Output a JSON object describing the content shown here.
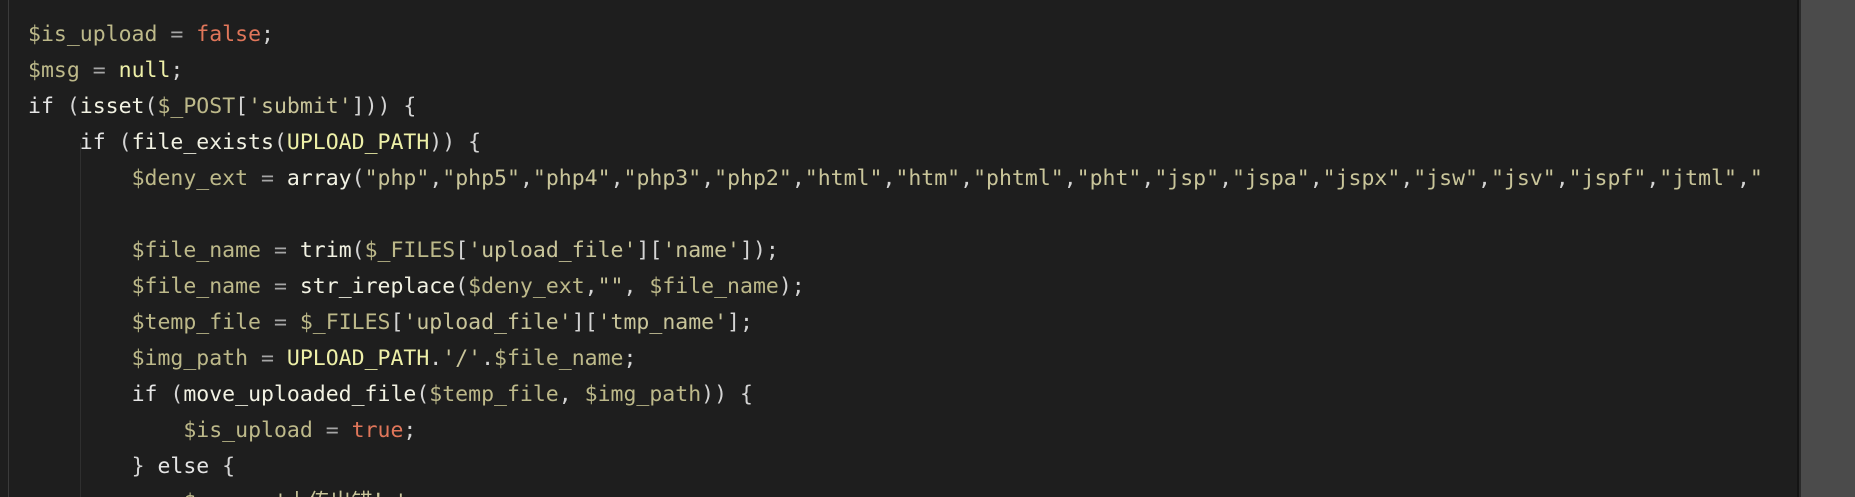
{
  "colors": {
    "background": "#1e1e1e",
    "variable": "#bdb98a",
    "keyword": "#e5e5e5",
    "function": "#f2f2e3",
    "constant": "#eef0a8",
    "string": "#c9c59a",
    "literal": "#e0765a",
    "operator": "#a6a6a6",
    "default": "#d4d4d4"
  },
  "editor": {
    "lines": [
      {
        "indent": 0,
        "tokens": [
          {
            "t": "$is_upload",
            "c": "variable"
          },
          {
            "t": " = ",
            "c": "operator"
          },
          {
            "t": "false",
            "c": "literal"
          },
          {
            "t": ";",
            "c": "default"
          }
        ]
      },
      {
        "indent": 0,
        "tokens": [
          {
            "t": "$msg",
            "c": "variable"
          },
          {
            "t": " = ",
            "c": "operator"
          },
          {
            "t": "null",
            "c": "constant"
          },
          {
            "t": ";",
            "c": "default"
          }
        ]
      },
      {
        "indent": 0,
        "tokens": [
          {
            "t": "if",
            "c": "keyword"
          },
          {
            "t": " (",
            "c": "default"
          },
          {
            "t": "isset",
            "c": "function"
          },
          {
            "t": "(",
            "c": "default"
          },
          {
            "t": "$_POST",
            "c": "variable"
          },
          {
            "t": "[",
            "c": "default"
          },
          {
            "t": "'submit'",
            "c": "string"
          },
          {
            "t": "])) {",
            "c": "default"
          }
        ]
      },
      {
        "indent": 1,
        "tokens": [
          {
            "t": "if",
            "c": "keyword"
          },
          {
            "t": " (",
            "c": "default"
          },
          {
            "t": "file_exists",
            "c": "function"
          },
          {
            "t": "(",
            "c": "default"
          },
          {
            "t": "UPLOAD_PATH",
            "c": "constant"
          },
          {
            "t": ")) {",
            "c": "default"
          }
        ]
      },
      {
        "indent": 2,
        "tokens": [
          {
            "t": "$deny_ext",
            "c": "variable"
          },
          {
            "t": " = ",
            "c": "operator"
          },
          {
            "t": "array",
            "c": "function"
          },
          {
            "t": "(",
            "c": "default"
          },
          {
            "t": "\"php\"",
            "c": "string"
          },
          {
            "t": ",",
            "c": "default"
          },
          {
            "t": "\"php5\"",
            "c": "string"
          },
          {
            "t": ",",
            "c": "default"
          },
          {
            "t": "\"php4\"",
            "c": "string"
          },
          {
            "t": ",",
            "c": "default"
          },
          {
            "t": "\"php3\"",
            "c": "string"
          },
          {
            "t": ",",
            "c": "default"
          },
          {
            "t": "\"php2\"",
            "c": "string"
          },
          {
            "t": ",",
            "c": "default"
          },
          {
            "t": "\"html\"",
            "c": "string"
          },
          {
            "t": ",",
            "c": "default"
          },
          {
            "t": "\"htm\"",
            "c": "string"
          },
          {
            "t": ",",
            "c": "default"
          },
          {
            "t": "\"phtml\"",
            "c": "string"
          },
          {
            "t": ",",
            "c": "default"
          },
          {
            "t": "\"pht\"",
            "c": "string"
          },
          {
            "t": ",",
            "c": "default"
          },
          {
            "t": "\"jsp\"",
            "c": "string"
          },
          {
            "t": ",",
            "c": "default"
          },
          {
            "t": "\"jspa\"",
            "c": "string"
          },
          {
            "t": ",",
            "c": "default"
          },
          {
            "t": "\"jspx\"",
            "c": "string"
          },
          {
            "t": ",",
            "c": "default"
          },
          {
            "t": "\"jsw\"",
            "c": "string"
          },
          {
            "t": ",",
            "c": "default"
          },
          {
            "t": "\"jsv\"",
            "c": "string"
          },
          {
            "t": ",",
            "c": "default"
          },
          {
            "t": "\"jspf\"",
            "c": "string"
          },
          {
            "t": ",",
            "c": "default"
          },
          {
            "t": "\"jtml\"",
            "c": "string"
          },
          {
            "t": ",",
            "c": "default"
          },
          {
            "t": "\"",
            "c": "string"
          }
        ]
      },
      {
        "indent": 0,
        "tokens": []
      },
      {
        "indent": 2,
        "tokens": [
          {
            "t": "$file_name",
            "c": "variable"
          },
          {
            "t": " = ",
            "c": "operator"
          },
          {
            "t": "trim",
            "c": "function"
          },
          {
            "t": "(",
            "c": "default"
          },
          {
            "t": "$_FILES",
            "c": "variable"
          },
          {
            "t": "[",
            "c": "default"
          },
          {
            "t": "'upload_file'",
            "c": "string"
          },
          {
            "t": "][",
            "c": "default"
          },
          {
            "t": "'name'",
            "c": "string"
          },
          {
            "t": "]);",
            "c": "default"
          }
        ]
      },
      {
        "indent": 2,
        "tokens": [
          {
            "t": "$file_name",
            "c": "variable"
          },
          {
            "t": " = ",
            "c": "operator"
          },
          {
            "t": "str_ireplace",
            "c": "function"
          },
          {
            "t": "(",
            "c": "default"
          },
          {
            "t": "$deny_ext",
            "c": "variable"
          },
          {
            "t": ",",
            "c": "default"
          },
          {
            "t": "\"\"",
            "c": "string"
          },
          {
            "t": ", ",
            "c": "default"
          },
          {
            "t": "$file_name",
            "c": "variable"
          },
          {
            "t": ");",
            "c": "default"
          }
        ]
      },
      {
        "indent": 2,
        "tokens": [
          {
            "t": "$temp_file",
            "c": "variable"
          },
          {
            "t": " = ",
            "c": "operator"
          },
          {
            "t": "$_FILES",
            "c": "variable"
          },
          {
            "t": "[",
            "c": "default"
          },
          {
            "t": "'upload_file'",
            "c": "string"
          },
          {
            "t": "][",
            "c": "default"
          },
          {
            "t": "'tmp_name'",
            "c": "string"
          },
          {
            "t": "];",
            "c": "default"
          }
        ]
      },
      {
        "indent": 2,
        "tokens": [
          {
            "t": "$img_path",
            "c": "variable"
          },
          {
            "t": " = ",
            "c": "operator"
          },
          {
            "t": "UPLOAD_PATH",
            "c": "constant"
          },
          {
            "t": ".",
            "c": "default"
          },
          {
            "t": "'/'",
            "c": "string"
          },
          {
            "t": ".",
            "c": "default"
          },
          {
            "t": "$file_name",
            "c": "variable"
          },
          {
            "t": ";",
            "c": "default"
          }
        ]
      },
      {
        "indent": 2,
        "tokens": [
          {
            "t": "if",
            "c": "keyword"
          },
          {
            "t": " (",
            "c": "default"
          },
          {
            "t": "move_uploaded_file",
            "c": "function"
          },
          {
            "t": "(",
            "c": "default"
          },
          {
            "t": "$temp_file",
            "c": "variable"
          },
          {
            "t": ", ",
            "c": "default"
          },
          {
            "t": "$img_path",
            "c": "variable"
          },
          {
            "t": ")) {",
            "c": "default"
          }
        ]
      },
      {
        "indent": 3,
        "tokens": [
          {
            "t": "$is_upload",
            "c": "variable"
          },
          {
            "t": " = ",
            "c": "operator"
          },
          {
            "t": "true",
            "c": "literal"
          },
          {
            "t": ";",
            "c": "default"
          }
        ]
      },
      {
        "indent": 2,
        "tokens": [
          {
            "t": "} ",
            "c": "default"
          },
          {
            "t": "else",
            "c": "keyword"
          },
          {
            "t": " {",
            "c": "default"
          }
        ]
      },
      {
        "indent": 3,
        "tokens": [
          {
            "t": "$msg",
            "c": "variable"
          },
          {
            "t": " = ",
            "c": "operator"
          },
          {
            "t": "'上传出错！'",
            "c": "string"
          },
          {
            "t": ";",
            "c": "default"
          }
        ]
      }
    ]
  }
}
